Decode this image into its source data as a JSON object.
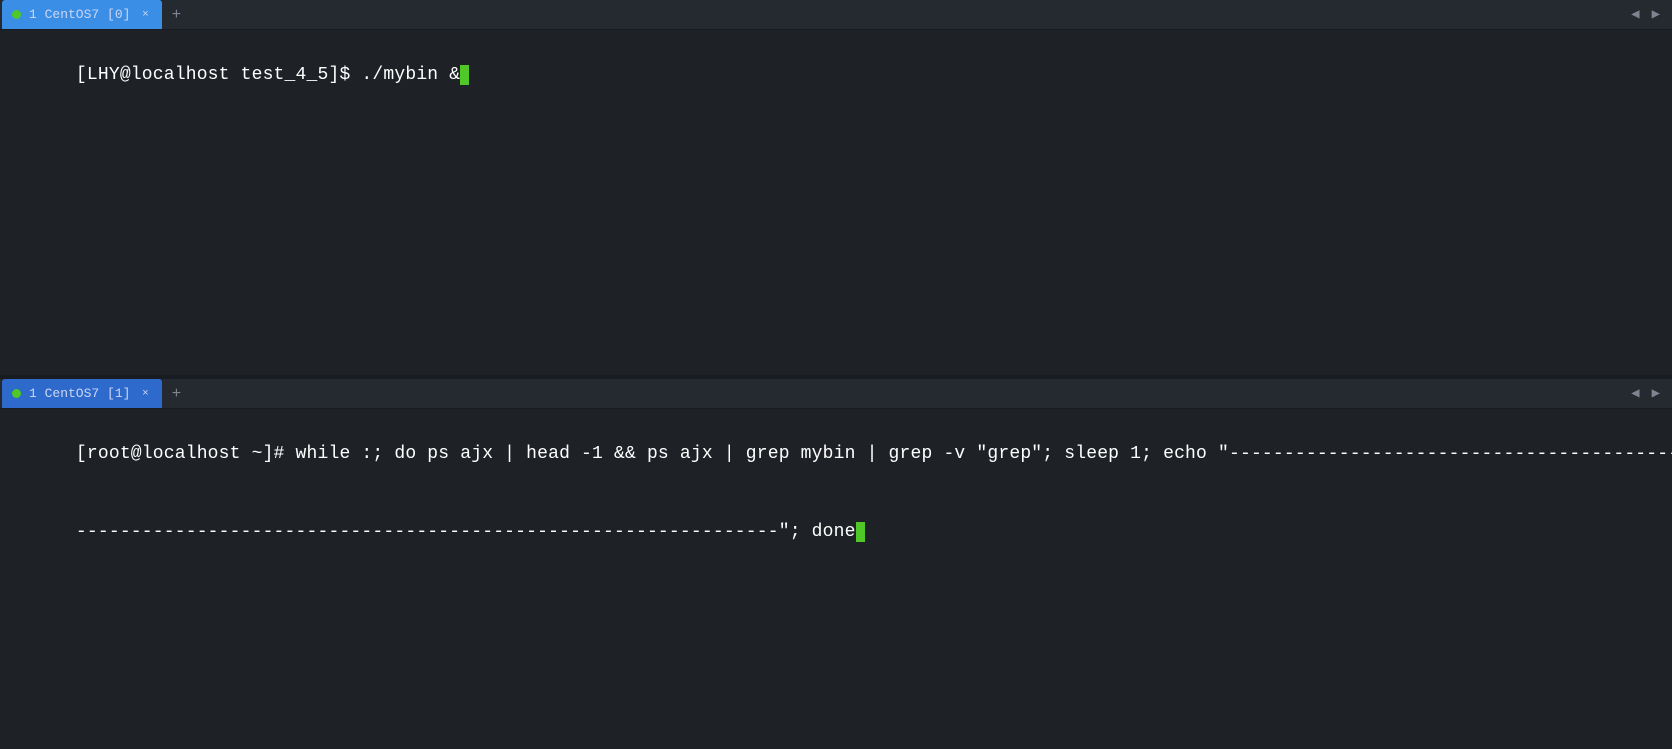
{
  "top_pane": {
    "tab": {
      "label": "1 CentOS7 [0]",
      "dot_color": "#4fc828",
      "close": "×"
    },
    "add_tab": "+",
    "nav_left": "◀",
    "nav_right": "▶",
    "terminal_lines": [
      "[LHY@localhost test_4_5]$ ./mybin &"
    ]
  },
  "bottom_pane": {
    "tab": {
      "label": "1 CentOS7 [1]",
      "dot_color": "#4fc828",
      "close": "×"
    },
    "add_tab": "+",
    "nav_left": "◀",
    "nav_right": "▶",
    "terminal_lines": [
      "[root@localhost ~]# while :; do ps ajx | head -1 && ps ajx | grep mybin | grep -v \"grep\"; sleep 1; echo \"----------------------------------------------------------------\"; done"
    ]
  }
}
